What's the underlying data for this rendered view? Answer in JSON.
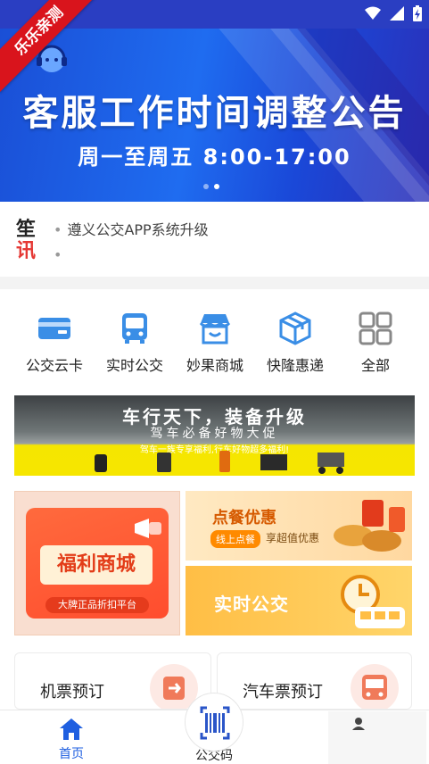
{
  "status_bar": {
    "ribbon_text": "乐乐亲测",
    "icons": [
      "wifi-icon",
      "signal-icon",
      "battery-charging-icon"
    ]
  },
  "banner": {
    "title": "客服工作时间调整公告",
    "subtitle": "周一至周五 8:00-17:00",
    "colors": {
      "primary": "#1f6cf0",
      "dark": "#2b2fb8"
    },
    "page_indicator": {
      "count": 2,
      "active": 1
    }
  },
  "notice": {
    "badge_top": "笙",
    "badge_bottom": "讯",
    "items": [
      "遵义公交APP系统升级",
      ""
    ]
  },
  "quick_access": [
    {
      "label": "公交云卡",
      "icon": "bus-card-icon"
    },
    {
      "label": "实时公交",
      "icon": "bus-icon"
    },
    {
      "label": "妙果商城",
      "icon": "store-icon"
    },
    {
      "label": "快隆惠递",
      "icon": "package-icon"
    },
    {
      "label": "全部",
      "icon": "grid-icon"
    }
  ],
  "promo_banner": {
    "title": "车行天下，装备升级",
    "subtitle": "驾车必备好物大促",
    "tagline": "驾车一族专享福利,行车好物超多福利!"
  },
  "cards": {
    "welfare_mall": {
      "title": "福利商城",
      "tag": "大牌正品折扣平台"
    },
    "food_order": {
      "title": "点餐优惠",
      "chip": "线上点餐",
      "subtitle": "享超值优惠"
    },
    "realtime_bus": {
      "title": "实时公交"
    }
  },
  "tickets": [
    {
      "label": "机票预订",
      "icon": "plane-ticket-icon"
    },
    {
      "label": "汽车票预订",
      "icon": "bus-ticket-icon"
    }
  ],
  "tab_bar": {
    "home": "首页",
    "code": "公交码",
    "mine": ""
  }
}
